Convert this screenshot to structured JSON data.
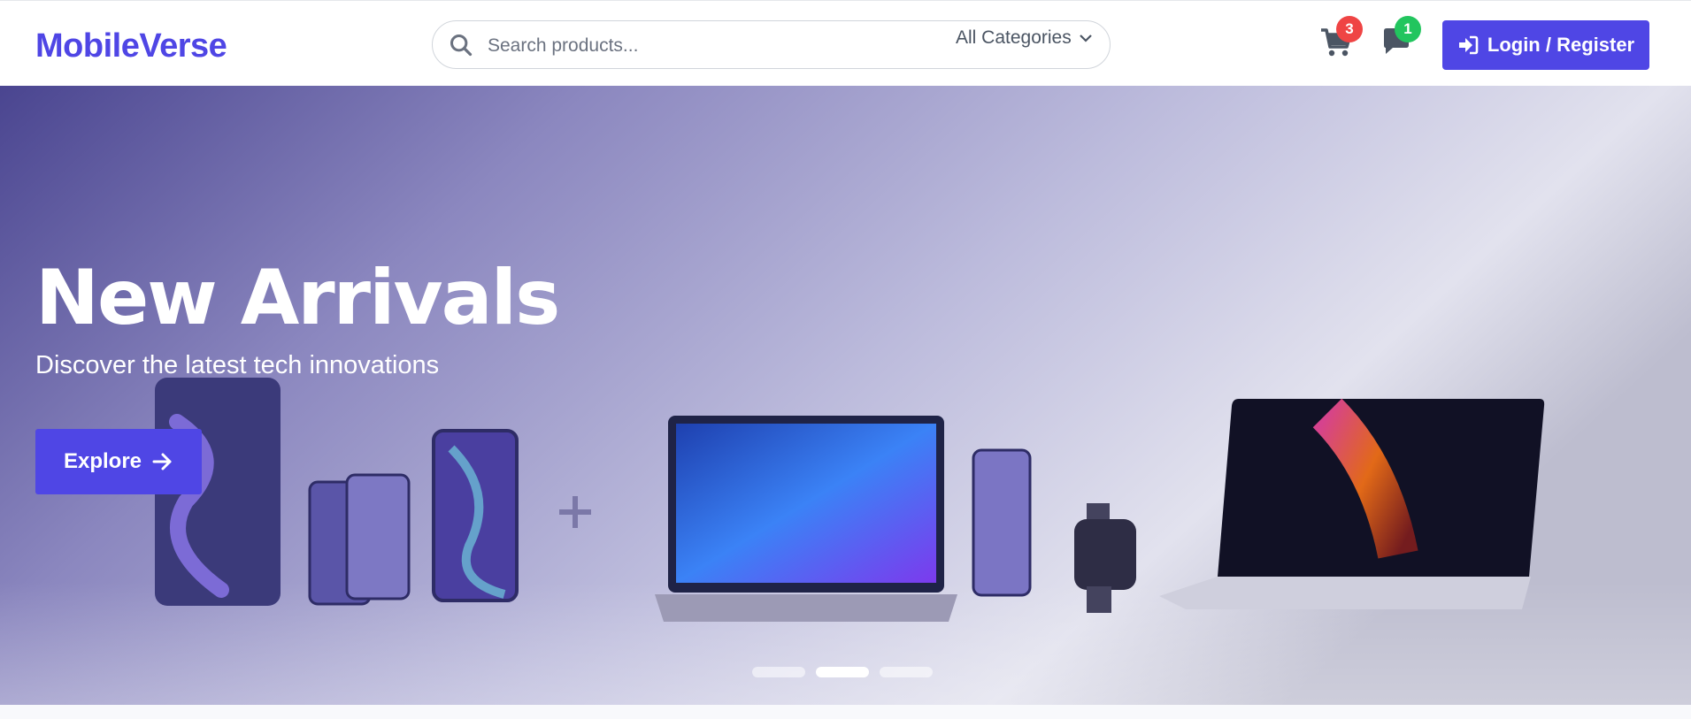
{
  "header": {
    "logo": "MobileVerse",
    "search": {
      "placeholder": "Search products...",
      "value": "",
      "category": "All Categories"
    },
    "cart": {
      "count": "3",
      "icon": "cart-icon"
    },
    "messages": {
      "count": "1",
      "icon": "chat-icon"
    },
    "login_label": "Login / Register"
  },
  "hero": {
    "title": "New Arrivals",
    "subtitle": "Discover the latest tech innovations",
    "cta_label": "Explore",
    "slides_total": 3,
    "active_slide": 2
  },
  "colors": {
    "accent": "#4f46e5",
    "cart_badge": "#ef4444",
    "chat_badge": "#22c55e"
  }
}
